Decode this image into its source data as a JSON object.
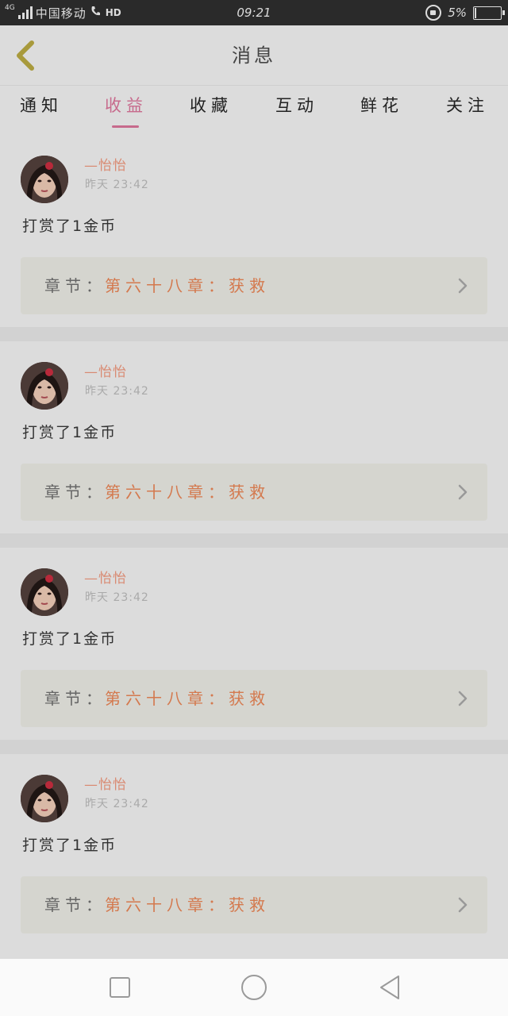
{
  "status_bar": {
    "network": "4G",
    "carrier": "中国移动",
    "hd": "HD",
    "time": "09:21",
    "battery": "5%",
    "battery_level": 0.05
  },
  "header": {
    "title": "消息"
  },
  "tabs": [
    {
      "label": "通知",
      "active": false
    },
    {
      "label": "收益",
      "active": true
    },
    {
      "label": "收藏",
      "active": false
    },
    {
      "label": "互动",
      "active": false
    },
    {
      "label": "鲜花",
      "active": false
    },
    {
      "label": "关注",
      "active": false
    }
  ],
  "messages": [
    {
      "user": "—怡怡",
      "time": "昨天 23:42",
      "text": "打赏了1金币",
      "chapter_label": "章节：",
      "chapter_name": "第六十八章：获救"
    },
    {
      "user": "—怡怡",
      "time": "昨天 23:42",
      "text": "打赏了1金币",
      "chapter_label": "章节：",
      "chapter_name": "第六十八章：获救"
    },
    {
      "user": "—怡怡",
      "time": "昨天 23:42",
      "text": "打赏了1金币",
      "chapter_label": "章节：",
      "chapter_name": "第六十八章：获救"
    },
    {
      "user": "—怡怡",
      "time": "昨天 23:42",
      "text": "打赏了1金币",
      "chapter_label": "章节：",
      "chapter_name": "第六十八章：获救"
    }
  ],
  "colors": {
    "accent": "#c76a8c",
    "username": "#d98a72",
    "chapter": "#d4794e",
    "back_arrow": "#a89a3c"
  },
  "icons": {
    "back": "chevron-left-icon",
    "chapter_arrow": "chevron-right-icon",
    "nav_recent": "square-icon",
    "nav_home": "circle-icon",
    "nav_back": "triangle-left-icon"
  }
}
